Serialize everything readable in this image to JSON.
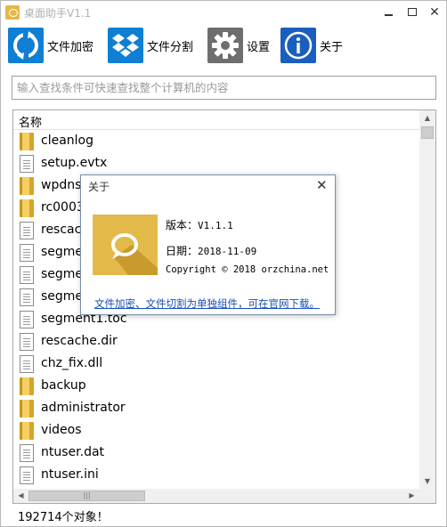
{
  "window": {
    "title": "桌面助手V1.1",
    "controls": {
      "minimize_icon": "minimize-icon",
      "maximize_icon": "maximize-icon",
      "close_icon": "close-icon",
      "close_glyph": "✕"
    }
  },
  "toolbar": {
    "items": [
      {
        "label": "文件加密",
        "icon": "refresh-sync-icon",
        "color": "#0f7fd3"
      },
      {
        "label": "文件分割",
        "icon": "dropbox-icon",
        "color": "#0f7fd3"
      },
      {
        "label": "设置",
        "icon": "gear-icon",
        "color": "#6e6e6e"
      },
      {
        "label": "关于",
        "icon": "info-icon",
        "color": "#1b5fbe"
      }
    ]
  },
  "search": {
    "placeholder": "输入查找条件可快速查找整个计算机的内容",
    "value": ""
  },
  "list": {
    "column_header": "名称",
    "rows": [
      {
        "name": "cleanlog",
        "type": "folder"
      },
      {
        "name": "setup.evtx",
        "type": "file"
      },
      {
        "name": "wpdns",
        "type": "folder"
      },
      {
        "name": "rc0003",
        "type": "folder"
      },
      {
        "name": "rescache",
        "type": "file"
      },
      {
        "name": "segme",
        "type": "file"
      },
      {
        "name": "segme",
        "type": "file"
      },
      {
        "name": "segme",
        "type": "file"
      },
      {
        "name": "segment1.toc",
        "type": "file"
      },
      {
        "name": "rescache.dir",
        "type": "file"
      },
      {
        "name": "chz_fix.dll",
        "type": "file"
      },
      {
        "name": "backup",
        "type": "folder"
      },
      {
        "name": "administrator",
        "type": "folder"
      },
      {
        "name": "videos",
        "type": "folder"
      },
      {
        "name": "ntuser.dat",
        "type": "file"
      },
      {
        "name": "ntuser.ini",
        "type": "file"
      }
    ],
    "scroll": {
      "up": "▲",
      "down": "▼",
      "left": "◀",
      "right": "▶",
      "hthumb_grip": "|||"
    }
  },
  "status": {
    "text": "192714个对象！"
  },
  "about_dialog": {
    "title": "关于",
    "close_glyph": "✕",
    "version_label": "版本：",
    "version_value": "V1.1.1",
    "date_label": "日期：",
    "date_value": "2018-11-09",
    "copyright": "Copyright © 2018 orzchina.net",
    "link_text": "文件加密、文件切割为单独组件，可在官网下载。",
    "logo_color": "#e3b94a"
  }
}
